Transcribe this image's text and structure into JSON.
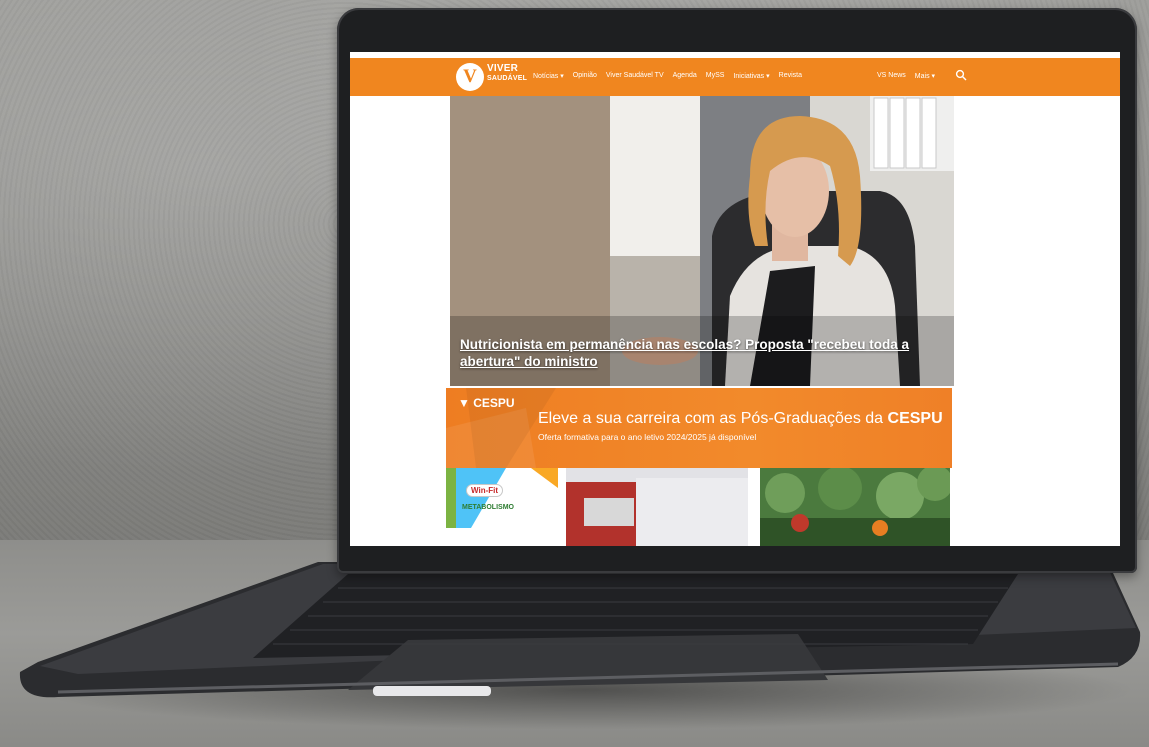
{
  "site": {
    "logo": {
      "line1": "VIVER",
      "line2": "SAUDÁVEL"
    },
    "nav": {
      "items": [
        {
          "label": "Notícias ▾"
        },
        {
          "label": "Opinião"
        },
        {
          "label": "Viver Saudável TV"
        },
        {
          "label": "Agenda"
        },
        {
          "label": "MySS"
        },
        {
          "label": "Iniciativas ▾"
        },
        {
          "label": "Revista"
        }
      ],
      "right": [
        {
          "label": "VS News"
        },
        {
          "label": "Mais ▾"
        }
      ]
    },
    "hero": {
      "headline": "Nutricionista em permanência nas escolas? Proposta \"recebeu toda a abertura\" do ministro"
    },
    "banner": {
      "brand": "CESPU",
      "title_prefix": "Eleve a sua carreira com as Pós-Graduações da",
      "title_brand": "CESPU",
      "subtitle": "Oferta formativa para o ano letivo 2024/2025 já disponível"
    },
    "cards": {
      "card1": {
        "badge": "Win-Fit",
        "label": "METABOLISMO"
      }
    }
  },
  "colors": {
    "brand_orange": "#f0861f",
    "banner_orange": "#ee7d22"
  },
  "icons": [
    "search-icon"
  ]
}
